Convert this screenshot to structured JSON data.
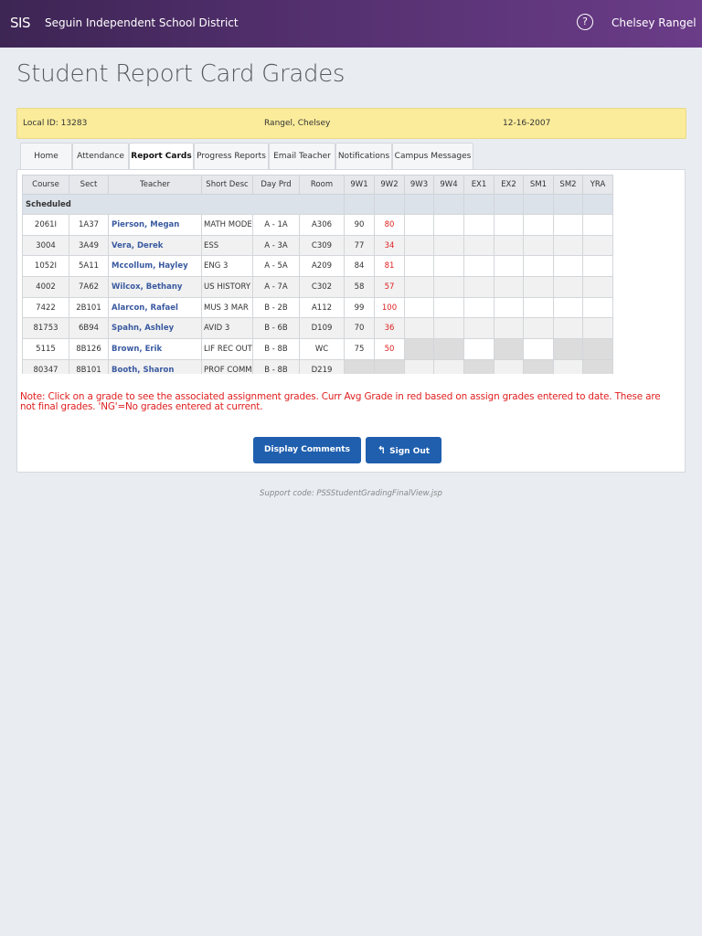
{
  "topbar": {
    "brand": "SIS",
    "district": "Seguin Independent School District",
    "help": "?",
    "user": "Chelsey Rangel"
  },
  "page_title": "Student Report Card Grades",
  "info": {
    "local_id": "Local ID: 13283",
    "name": "Rangel, Chelsey",
    "dob": "12-16-2007"
  },
  "tabs": [
    "Home",
    "Attendance",
    "Report Cards",
    "Progress Reports",
    "Email Teacher",
    "Notifications",
    "Campus Messages"
  ],
  "active_tab": "Report Cards",
  "table": {
    "headers": [
      "Course",
      "Sect",
      "Teacher",
      "Short Desc",
      "Day Prd",
      "Room",
      "9W1",
      "9W2",
      "9W3",
      "9W4",
      "EX1",
      "EX2",
      "SM1",
      "SM2",
      "YRA"
    ],
    "group_label": "Scheduled",
    "rows": [
      [
        "2061I",
        "1A37",
        "Pierson, Megan",
        "MATH MODELS",
        "A - 1A",
        "A306",
        "90",
        "80"
      ],
      [
        "3004",
        "3A49",
        "Vera, Derek",
        "ESS",
        "A - 3A",
        "C309",
        "77",
        "34"
      ],
      [
        "1052I",
        "5A11",
        "Mccollum, Hayley",
        "ENG 3",
        "A - 5A",
        "A209",
        "84",
        "81"
      ],
      [
        "4002",
        "7A62",
        "Wilcox, Bethany",
        "US HISTORY",
        "A - 7A",
        "C302",
        "58",
        "57"
      ],
      [
        "7422",
        "2B101",
        "Alarcon, Rafael",
        "MUS 3 MAR",
        "B - 2B",
        "A112",
        "99",
        "100"
      ],
      [
        "81753",
        "6B94",
        "Spahn, Ashley",
        "AVID 3",
        "B - 6B",
        "D109",
        "70",
        "36"
      ],
      [
        "5115",
        "8B126",
        "Brown, Erik",
        "LIF REC OUTDOOR",
        "B - 8B",
        "WC",
        "75",
        "50"
      ],
      [
        "80347",
        "8B101",
        "Booth, Sharon",
        "PROF COMM",
        "B - 8B",
        "D219",
        "",
        ""
      ]
    ]
  },
  "note": "Note: Click on a grade to see the associated assignment grades. Curr Avg Grade in red based on assign grades entered to date. These are not final grades. 'NG'=No grades entered at current.",
  "buttons": {
    "display_comments": "Display Comments",
    "sign_out": "Sign Out"
  },
  "support": "Support code: PSSStudentGradingFinalView.jsp",
  "colors": {
    "header_start": "#3d2554",
    "header_end": "#6b3c88",
    "info_bg": "#fbec9b",
    "button": "#1f5fae",
    "current_grade": "#e01e1e",
    "teacher_link": "#3a5aa0"
  }
}
